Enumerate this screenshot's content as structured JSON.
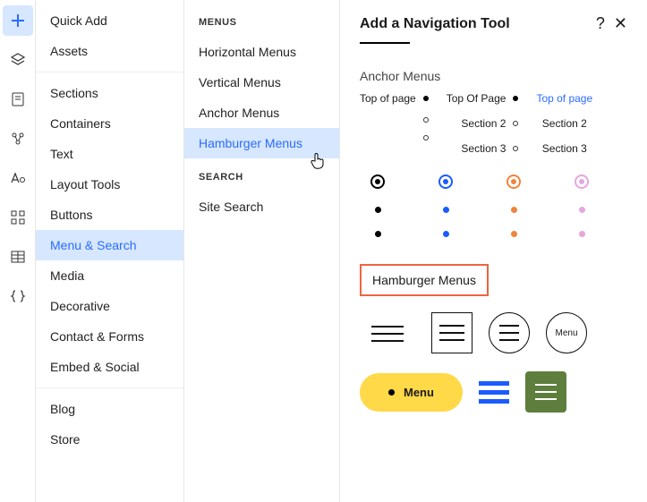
{
  "rail": {
    "items": [
      "plus",
      "layers",
      "page",
      "shapes",
      "text",
      "grid",
      "table",
      "braces"
    ],
    "activeIndex": 0
  },
  "col1": {
    "group1": [
      {
        "label": "Quick Add"
      },
      {
        "label": "Assets"
      }
    ],
    "group2": [
      {
        "label": "Sections"
      },
      {
        "label": "Containers"
      },
      {
        "label": "Text"
      },
      {
        "label": "Layout Tools"
      },
      {
        "label": "Buttons"
      },
      {
        "label": "Menu & Search",
        "active": true
      },
      {
        "label": "Media"
      },
      {
        "label": "Decorative"
      },
      {
        "label": "Contact & Forms"
      },
      {
        "label": "Embed & Social"
      }
    ],
    "group3": [
      {
        "label": "Blog"
      },
      {
        "label": "Store"
      }
    ]
  },
  "col2": {
    "menusHeader": "MENUS",
    "menus": [
      {
        "label": "Horizontal Menus"
      },
      {
        "label": "Vertical Menus"
      },
      {
        "label": "Anchor Menus"
      },
      {
        "label": "Hamburger Menus",
        "active": true
      }
    ],
    "searchHeader": "SEARCH",
    "search": [
      {
        "label": "Site Search"
      }
    ]
  },
  "panel": {
    "title": "Add a Navigation Tool",
    "help": "?",
    "close": "✕",
    "anchorLabel": "Anchor Menus",
    "anchorCols": [
      {
        "style": "filled",
        "items": [
          "Top of page",
          "",
          ""
        ]
      },
      {
        "style": "filled",
        "items": [
          "Top Of Page",
          "Section 2",
          "Section 3"
        ]
      },
      {
        "style": "open",
        "items": [
          "",
          "",
          ""
        ]
      },
      {
        "style": "link",
        "items": [
          "Top of page",
          "Section 2",
          "Section 3"
        ]
      }
    ],
    "colors": [
      "#000000",
      "#1b5cff",
      "#f0843b",
      "#d9a6e8"
    ],
    "hamburgerLabel": "Hamburger Menus",
    "pillLabel": "Menu",
    "circMenuLabel": "Menu"
  }
}
